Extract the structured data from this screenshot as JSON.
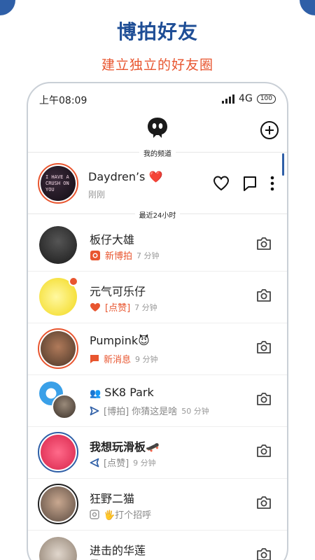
{
  "promo": {
    "title": "博拍好友",
    "subtitle": "建立独立的好友圈"
  },
  "status_bar": {
    "time": "上午08:09",
    "network": "4G",
    "battery": "100"
  },
  "header": {
    "my_channel_label": "我的频道",
    "recent_label": "最近24小时"
  },
  "channel": {
    "name": "Daydren’s ❤️",
    "time": "刚刚",
    "avatar_text": "I HAVE A CRUSH ON YOU"
  },
  "friends": [
    {
      "name": "板仔大雄",
      "status": "新博拍",
      "time": "7 分钟",
      "status_color": "#e8552f",
      "status_icon": "camera-record-icon"
    },
    {
      "name": "元气可乐仔",
      "status": "[点赞]",
      "time": "7 分钟",
      "status_color": "#e8552f",
      "status_icon": "heart-icon"
    },
    {
      "name": "Pumpink😈",
      "status": "新消息",
      "time": "9 分钟",
      "status_color": "#e8552f",
      "status_icon": "chat-icon"
    },
    {
      "name": "SK8 Park",
      "status": "[博拍] 你猜这是啥",
      "time": "50 分钟",
      "status_color": "#888888",
      "status_icon": "sent-arrow-icon",
      "prefix": "👥"
    },
    {
      "name": "我想玩滑板🛹",
      "status": "[点赞]",
      "time": "9 分钟",
      "status_color": "#888888",
      "status_icon": "sent-outline-icon"
    },
    {
      "name": "狂野二猫",
      "status": "🖐️打个招呼",
      "time": "",
      "status_color": "#888888",
      "status_icon": "camera-outline-icon"
    },
    {
      "name": "进击的华莲",
      "status": "",
      "time": "",
      "status_color": "#888888",
      "status_icon": "camera-outline-icon"
    }
  ],
  "colors": {
    "brand_blue": "#1f4e96",
    "accent_orange": "#e8552f"
  }
}
